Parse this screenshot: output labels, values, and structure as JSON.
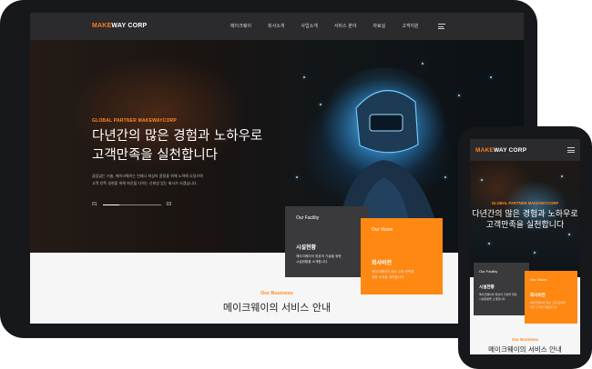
{
  "brand": {
    "logo_accent": "MAKE",
    "logo_rest": "WAY CORP"
  },
  "tablet": {
    "nav": [
      "메이크웨이",
      "회사소개",
      "사업소개",
      "서비스 분야",
      "자료실",
      "고객지원"
    ],
    "hero": {
      "subtitle": "GLOBAL PARTNER MAKEWAYCORP",
      "title_line1": "다년간의 많은 경험과 노하우로",
      "title_line2": "고객만족을 실천합니다",
      "desc_line1": "끊임없는 기술, 메이크웨이는 언제나 최상의 품질을 위해 노력해 오었으며",
      "desc_line2": "고객 만족 실현을 위해 최선을 다하는 신뢰성 있는 회사가 되겠습니다.",
      "pager_start": "01",
      "pager_end": "03"
    },
    "card_facility": {
      "label": "Our Facility",
      "title": "시설현황",
      "desc_line1": "메이크웨이의 최상의 기술을 위한",
      "desc_line2": "시설현황을 소개합니다."
    },
    "card_vision": {
      "label": "Our Vision",
      "title": "회사비전",
      "desc_line1": "메이크웨이의 정상 고객 만족을",
      "desc_line2": "위한 노력을 계속합니다."
    },
    "section": {
      "subtitle": "Our Business",
      "title": "메이크웨이의 서비스 안내"
    }
  },
  "phone": {
    "hero": {
      "subtitle": "GLOBAL PARTNER MAKEWAYCORP",
      "title_line1": "다년간의 많은 경험과 노하우로",
      "title_line2": "고객만족을 실천합니다"
    },
    "card_facility": {
      "label": "Our Facility",
      "title": "시설현황",
      "desc_line1": "메이크웨이의 최상의 기술을 위한",
      "desc_line2": "시설현황을 소개합니다."
    },
    "card_vision": {
      "label": "Our Vision",
      "title": "회사비전",
      "desc_line1": "메이크웨이의 정상 고객 만족을",
      "desc_line2": "위한 노력을 계속합니다."
    },
    "section": {
      "subtitle": "Our Business",
      "title": "메이크웨이의 서비스 안내"
    }
  },
  "colors": {
    "accent": "#ff8812",
    "device": "#17181b",
    "header": "#2b2b2d",
    "card_dark": "#3a3a3c"
  },
  "icons": {
    "menu": "hamburger-menu-icon"
  }
}
